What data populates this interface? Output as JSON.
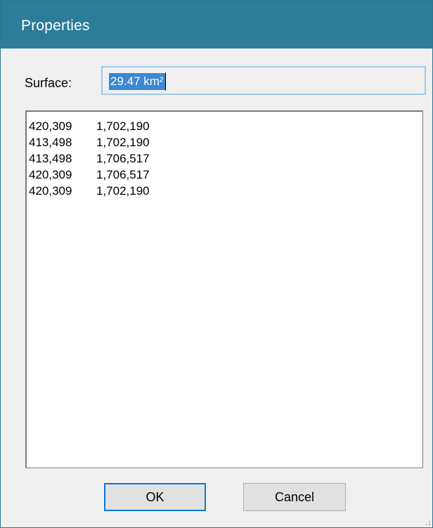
{
  "window": {
    "title": "Properties"
  },
  "surface": {
    "label": "Surface:",
    "value": "29.47 km²"
  },
  "coordinates": [
    {
      "x": "420,309",
      "y": "1,702,190"
    },
    {
      "x": "413,498",
      "y": "1,702,190"
    },
    {
      "x": "413,498",
      "y": "1,706,517"
    },
    {
      "x": "420,309",
      "y": "1,706,517"
    },
    {
      "x": "420,309",
      "y": "1,702,190"
    }
  ],
  "buttons": {
    "ok_label": "OK",
    "cancel_label": "Cancel"
  },
  "colors": {
    "titlebar": "#2d7c99",
    "selection": "#3c86d2",
    "default_button_border": "#0a78d7"
  }
}
